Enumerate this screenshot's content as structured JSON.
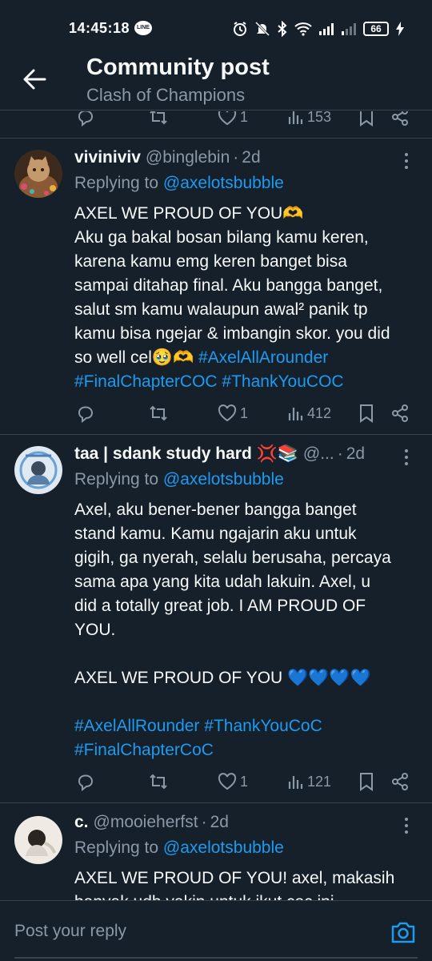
{
  "status_bar": {
    "time": "14:45:18",
    "battery": "66",
    "line_badge": "LINE"
  },
  "header": {
    "title": "Community post",
    "subtitle": "Clash of Champions"
  },
  "top_actions": {
    "likes": "1",
    "views": "153"
  },
  "posts": [
    {
      "name": "viviniviv",
      "handle": "@binglebin",
      "time": "2d",
      "replying_prefix": "Replying to ",
      "replying_to": "@axelotsbubble",
      "lines": [
        "AXEL WE PROUD OF YOU🫶",
        "Aku ga bakal bosan bilang kamu keren,",
        "karena kamu emg keren banget bisa",
        "sampai ditahap final. Aku bangga banget,",
        "salut sm kamu walaupun awal² panik tp",
        "kamu bisa ngejar & imbangin skor. you did"
      ],
      "last_line_text": "so well cel🥹🫶 ",
      "tags": [
        "#AxelAllArounder",
        "#FinalChapterCOC",
        "#ThankYouCOC"
      ],
      "likes": "1",
      "views": "412"
    },
    {
      "name": "taa | sdank study hard 💢📚",
      "handle": "@...",
      "time": "2d",
      "replying_prefix": "Replying to ",
      "replying_to": "@axelotsbubble",
      "lines": [
        "Axel, aku bener-bener bangga banget",
        "stand kamu. Kamu ngajarin aku untuk",
        "gigih, ga nyerah, selalu berusaha, percaya",
        "sama apa yang kita udah lakuin. Axel, u",
        "did a totally great job. I AM PROUD OF",
        "YOU.",
        "",
        "AXEL WE PROUD OF YOU 💙💙💙💙",
        ""
      ],
      "tags": [
        "#AxelAllRounder",
        "#ThankYouCoC",
        "#FinalChapterCoC"
      ],
      "likes": "1",
      "views": "121"
    },
    {
      "name": "c.",
      "handle": "@mooieherfst",
      "time": "2d",
      "replying_prefix": "Replying to ",
      "replying_to": "@axelotsbubble",
      "lines": [
        "AXEL WE PROUD OF YOU! axel, makasih",
        "banyak udh yakin untuk ikut coc ini"
      ]
    }
  ],
  "reply_bar": {
    "placeholder": "Post your reply"
  },
  "colors": {
    "background": "#15202b",
    "accent": "#1d9bf0",
    "muted": "#8b98a5",
    "divider": "#38444d"
  },
  "icons": [
    "back-arrow-icon",
    "reply-icon",
    "retweet-icon",
    "heart-icon",
    "views-icon",
    "bookmark-icon",
    "share-icon",
    "more-icon",
    "camera-icon",
    "alarm-icon",
    "mute-icon",
    "bluetooth-icon",
    "wifi-icon",
    "signal-icon",
    "battery-icon",
    "charging-icon"
  ]
}
